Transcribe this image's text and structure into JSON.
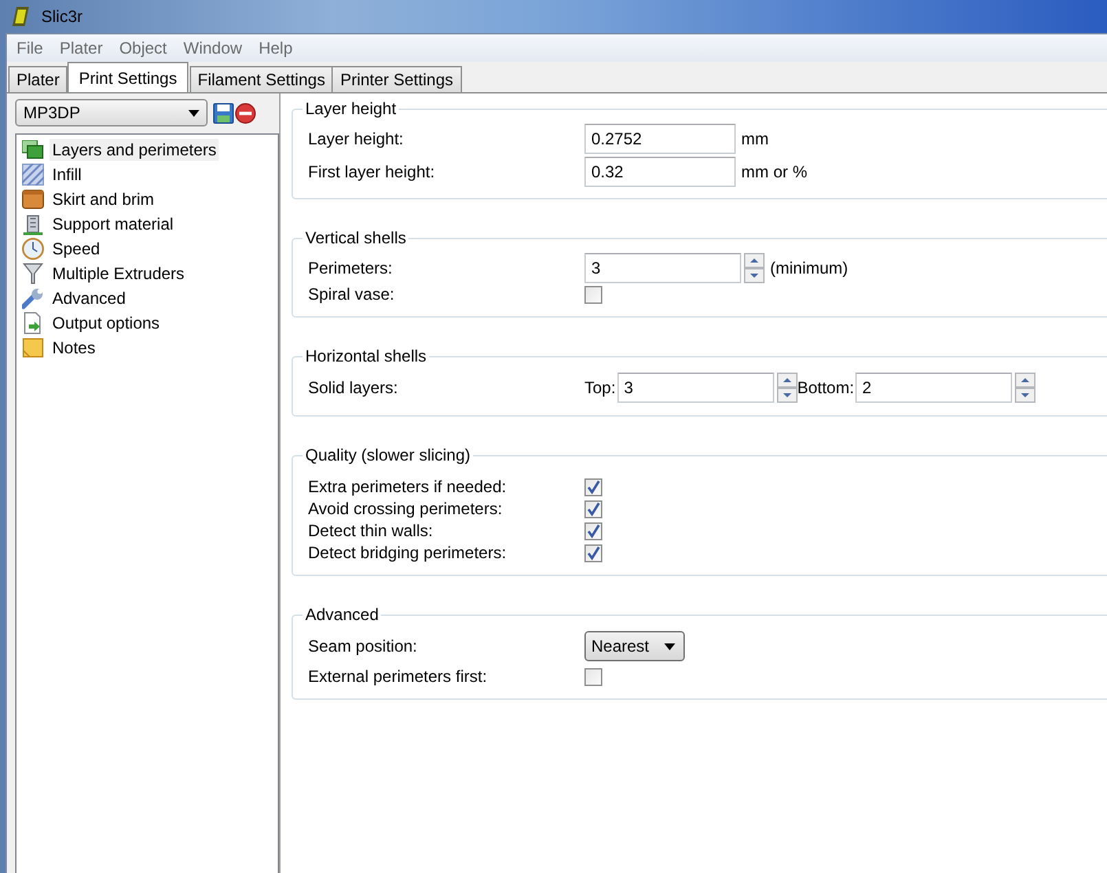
{
  "window": {
    "title": "Slic3r"
  },
  "menu": [
    "File",
    "Plater",
    "Object",
    "Window",
    "Help"
  ],
  "tabs": [
    {
      "label": "Plater",
      "selected": false
    },
    {
      "label": "Print Settings",
      "selected": true
    },
    {
      "label": "Filament Settings",
      "selected": false
    },
    {
      "label": "Printer Settings",
      "selected": false
    }
  ],
  "preset": {
    "value": "MP3DP"
  },
  "sidebar": {
    "items": [
      {
        "label": "Layers and perimeters",
        "selected": true
      },
      {
        "label": "Infill",
        "selected": false
      },
      {
        "label": "Skirt and brim",
        "selected": false
      },
      {
        "label": "Support material",
        "selected": false
      },
      {
        "label": "Speed",
        "selected": false
      },
      {
        "label": "Multiple Extruders",
        "selected": false
      },
      {
        "label": "Advanced",
        "selected": false
      },
      {
        "label": "Output options",
        "selected": false
      },
      {
        "label": "Notes",
        "selected": false
      }
    ]
  },
  "sections": [
    {
      "title": "Layer height",
      "rows": [
        {
          "kind": "text",
          "label": "Layer height:",
          "value": "0.2752",
          "unit": "mm"
        },
        {
          "kind": "text",
          "label": "First layer height:",
          "value": "0.32",
          "unit": "mm or %"
        }
      ]
    },
    {
      "title": "Vertical shells",
      "rows": [
        {
          "kind": "spin",
          "label": "Perimeters:",
          "value": "3",
          "unit": "(minimum)"
        },
        {
          "kind": "check",
          "label": "Spiral vase:",
          "checked": false
        }
      ]
    },
    {
      "title": "Horizontal shells",
      "rows": [
        {
          "kind": "spin_pair",
          "label": "Solid layers:",
          "parts": [
            {
              "label": "Top:",
              "value": "3"
            },
            {
              "label": "Bottom:",
              "value": "2"
            }
          ]
        }
      ]
    },
    {
      "title": "Quality (slower slicing)",
      "rows": [
        {
          "kind": "check",
          "label": "Extra perimeters if needed:",
          "checked": true
        },
        {
          "kind": "check",
          "label": "Avoid crossing perimeters:",
          "checked": true
        },
        {
          "kind": "check",
          "label": "Detect thin walls:",
          "checked": true
        },
        {
          "kind": "check",
          "label": "Detect bridging perimeters:",
          "checked": true
        }
      ]
    },
    {
      "title": "Advanced",
      "rows": [
        {
          "kind": "select",
          "label": "Seam position:",
          "value": "Nearest"
        },
        {
          "kind": "check",
          "label": "External perimeters first:",
          "checked": false
        }
      ]
    }
  ]
}
